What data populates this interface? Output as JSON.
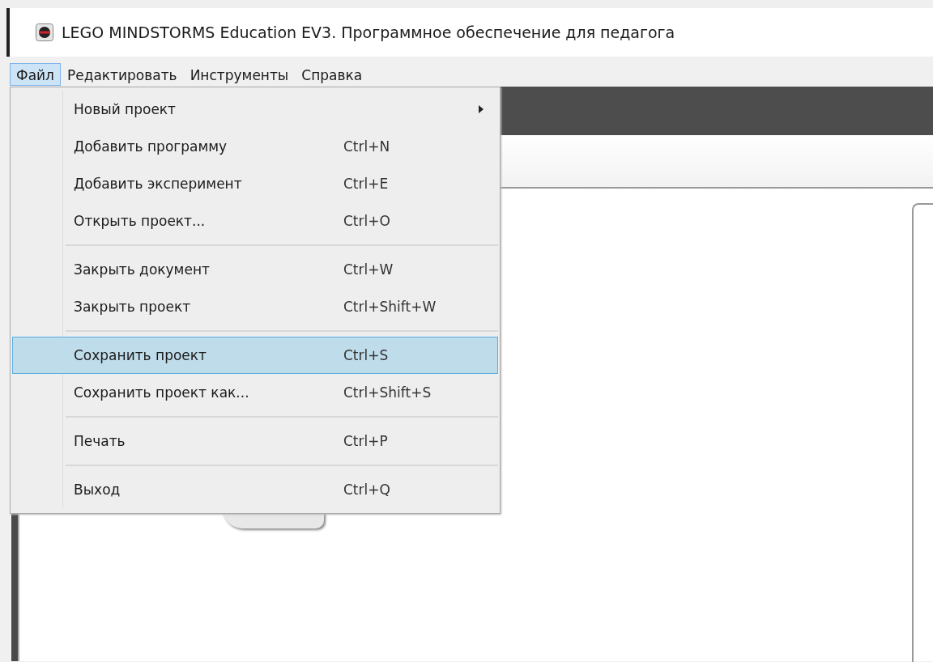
{
  "window": {
    "title": "LEGO MINDSTORMS Education EV3. Программное обеспечение для педагога"
  },
  "menu_bar": [
    {
      "label": "Файл",
      "selected": true
    },
    {
      "label": "Редактировать",
      "selected": false
    },
    {
      "label": "Инструменты",
      "selected": false
    },
    {
      "label": "Справка",
      "selected": false
    }
  ],
  "file_menu": [
    {
      "kind": "item",
      "label": "Новый проект",
      "submenu": true,
      "selected": false
    },
    {
      "kind": "item",
      "label": "Добавить программу",
      "shortcut": "Ctrl+N",
      "submenu": false,
      "selected": false
    },
    {
      "kind": "item",
      "label": "Добавить эксперимент",
      "shortcut": "Ctrl+E",
      "submenu": false,
      "selected": false
    },
    {
      "kind": "item",
      "label": "Открыть проект...",
      "shortcut": "Ctrl+O",
      "submenu": false,
      "selected": false
    },
    {
      "kind": "separator"
    },
    {
      "kind": "item",
      "label": "Закрыть документ",
      "shortcut": "Ctrl+W",
      "submenu": false,
      "selected": false
    },
    {
      "kind": "item",
      "label": "Закрыть проект",
      "shortcut": "Ctrl+Shift+W",
      "submenu": false,
      "selected": false
    },
    {
      "kind": "separator"
    },
    {
      "kind": "item",
      "label": "Сохранить проект",
      "shortcut": "Ctrl+S",
      "submenu": false,
      "selected": true
    },
    {
      "kind": "item",
      "label": "Сохранить проект как...",
      "shortcut": "Ctrl+Shift+S",
      "submenu": false,
      "selected": false
    },
    {
      "kind": "separator"
    },
    {
      "kind": "item",
      "label": "Печать",
      "shortcut": "Ctrl+P",
      "submenu": false,
      "selected": false
    },
    {
      "kind": "separator"
    },
    {
      "kind": "item",
      "label": "Выход",
      "shortcut": "Ctrl+Q",
      "submenu": false,
      "selected": false
    }
  ]
}
